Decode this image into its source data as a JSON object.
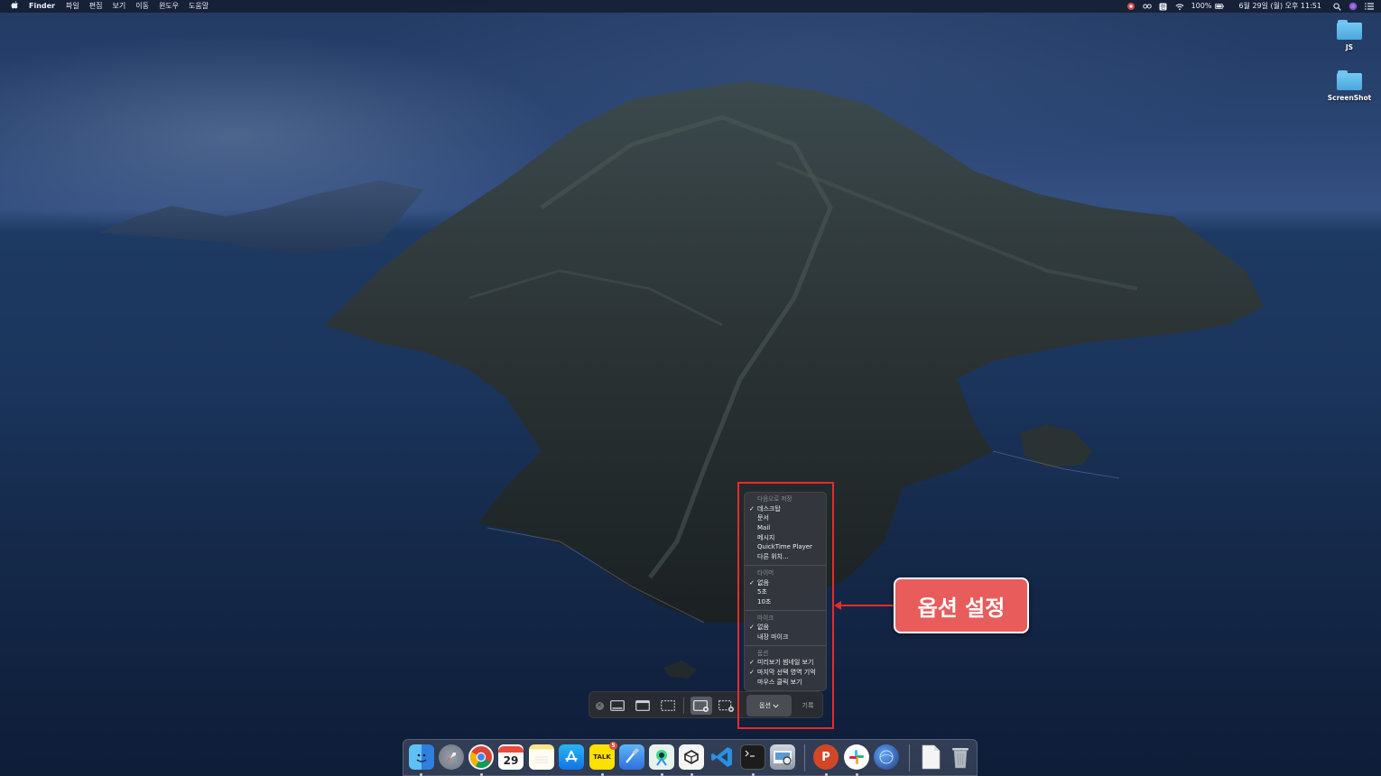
{
  "menubar": {
    "apple_icon": "apple-logo-icon",
    "app_name": "Finder",
    "menus": [
      "파일",
      "편집",
      "보기",
      "이동",
      "윈도우",
      "도움말"
    ],
    "battery": "100%",
    "clock": "6월 29일 (월) 오후 11:51"
  },
  "desktop": {
    "icons": [
      {
        "label": "JS",
        "icon": "folder-icon"
      },
      {
        "label": "ScreenShot",
        "icon": "folder-icon"
      }
    ]
  },
  "toolbar": {
    "options_label": "옵션",
    "record_label": "기록"
  },
  "options_menu": {
    "save_to": {
      "header": "다음으로 저장",
      "items": [
        {
          "label": "데스크탑",
          "checked": true
        },
        {
          "label": "문서",
          "checked": false
        },
        {
          "label": "Mail",
          "checked": false
        },
        {
          "label": "메시지",
          "checked": false
        },
        {
          "label": "QuickTime Player",
          "checked": false
        },
        {
          "label": "다른 위치...",
          "checked": false
        }
      ]
    },
    "timer": {
      "header": "타이머",
      "items": [
        {
          "label": "없음",
          "checked": true
        },
        {
          "label": "5초",
          "checked": false
        },
        {
          "label": "10초",
          "checked": false
        }
      ]
    },
    "microphone": {
      "header": "마이크",
      "items": [
        {
          "label": "없음",
          "checked": true
        },
        {
          "label": "내장 마이크",
          "checked": false
        }
      ]
    },
    "options": {
      "header": "옵션",
      "items": [
        {
          "label": "미리보기 썸네일 보기",
          "checked": true
        },
        {
          "label": "마지막 선택 영역 기억",
          "checked": true
        },
        {
          "label": "마우스 클릭 보기",
          "checked": false
        }
      ]
    },
    "check_mark": "✓"
  },
  "annotation": {
    "label": "옵션 설정",
    "color": "#e62b2b"
  },
  "dock": {
    "calendar_day": "29",
    "kakaotalk_label": "TALK",
    "kakaotalk_badge": "5",
    "powerpoint_label": "P"
  }
}
